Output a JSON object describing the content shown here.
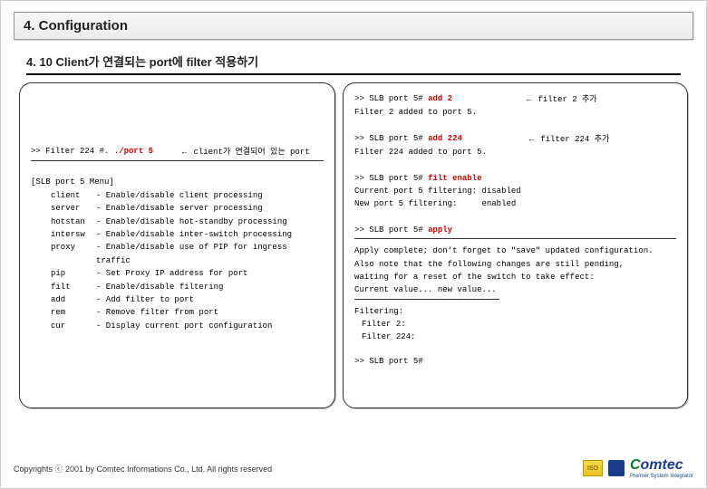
{
  "title": "4. Configuration",
  "subtitle": "4. 10 Client가 연결되는 port에 filter 적용하기",
  "left": {
    "line1_prefix": ">> Filter 224  # ",
    "line1_cmd": ". ./port 5",
    "line1_arrow": "←",
    "line1_note": "client가 연결되어 있는 port",
    "menu_header": "[SLB port 5 Menu]",
    "menu": [
      {
        "k": "client",
        "d": "- Enable/disable client processing"
      },
      {
        "k": "server",
        "d": "- Enable/disable server processing"
      },
      {
        "k": "hotstan",
        "d": "- Enable/disable hot-standby processing"
      },
      {
        "k": "intersw",
        "d": "- Enable/disable inter-switch processing"
      },
      {
        "k": "proxy",
        "d": "- Enable/disable use of PIP for ingress traffic"
      },
      {
        "k": "pip",
        "d": "- Set Proxy IP address for port"
      },
      {
        "k": "filt",
        "d": "- Enable/disable filtering"
      },
      {
        "k": "add",
        "d": "- Add filter to port"
      },
      {
        "k": "rem",
        "d": "- Remove filter from port"
      },
      {
        "k": "cur",
        "d": "- Display current port configuration"
      }
    ]
  },
  "right": {
    "r1_prefix": ">> SLB port 5# ",
    "r1_cmd": "add 2",
    "r1_arrow": "←",
    "r1_note": "filter 2 추가",
    "r1_result": "Filter 2 added to port 5.",
    "r2_prefix": ">> SLB port 5# ",
    "r2_cmd": "add 224",
    "r2_arrow": "←",
    "r2_note": "filter 224 추가",
    "r2_result": "Filter 224 added to port 5.",
    "r3_prefix": ">> SLB port 5# ",
    "r3_cmd": "filt enable",
    "r3_line2": "Current port 5 filtering: disabled",
    "r3_line3a": "New port 5 filtering:",
    "r3_line3b": "enabled",
    "r4_prefix": ">> SLB port 5# ",
    "r4_cmd": "apply",
    "r4_l1": "Apply complete; don't forget to \"save\" updated configuration.",
    "r4_l2": "Also note that the following changes are still pending,",
    "r4_l3": " waiting for a reset of the switch to take effect:",
    "r4_l4": "Current value...   new value...",
    "r4_fhead": "Filtering:",
    "r4_f1": "Filter 2:",
    "r4_f2": "Filter 224:",
    "r5": ">> SLB port 5#"
  },
  "footer": {
    "copyright": "Copyrights ⓒ 2001 by Comtec Informations Co., Ltd. All rights reserved",
    "logo": "Comtec",
    "logo_sub": "Premier System Integrator"
  }
}
